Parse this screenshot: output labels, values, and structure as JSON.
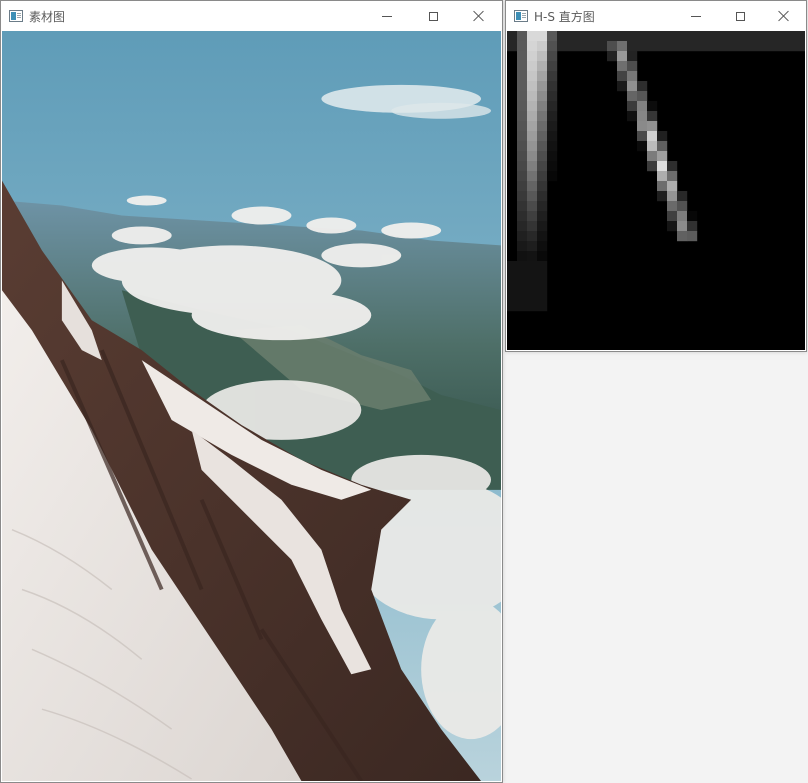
{
  "source_window": {
    "title": "素材图",
    "image_subject": "mountain-glacier-landscape-photo"
  },
  "histogram_window": {
    "title": "H-S 直方图",
    "grid_columns": 30,
    "grid_rows": 32
  },
  "icons": {
    "app": "app-window-icon",
    "minimize": "minimize-icon",
    "maximize": "maximize-icon",
    "close": "close-icon"
  },
  "colors": {
    "titlebar_bg": "#ffffff",
    "desktop_bg": "#f3f3f3",
    "histogram_bg": "#000000"
  }
}
